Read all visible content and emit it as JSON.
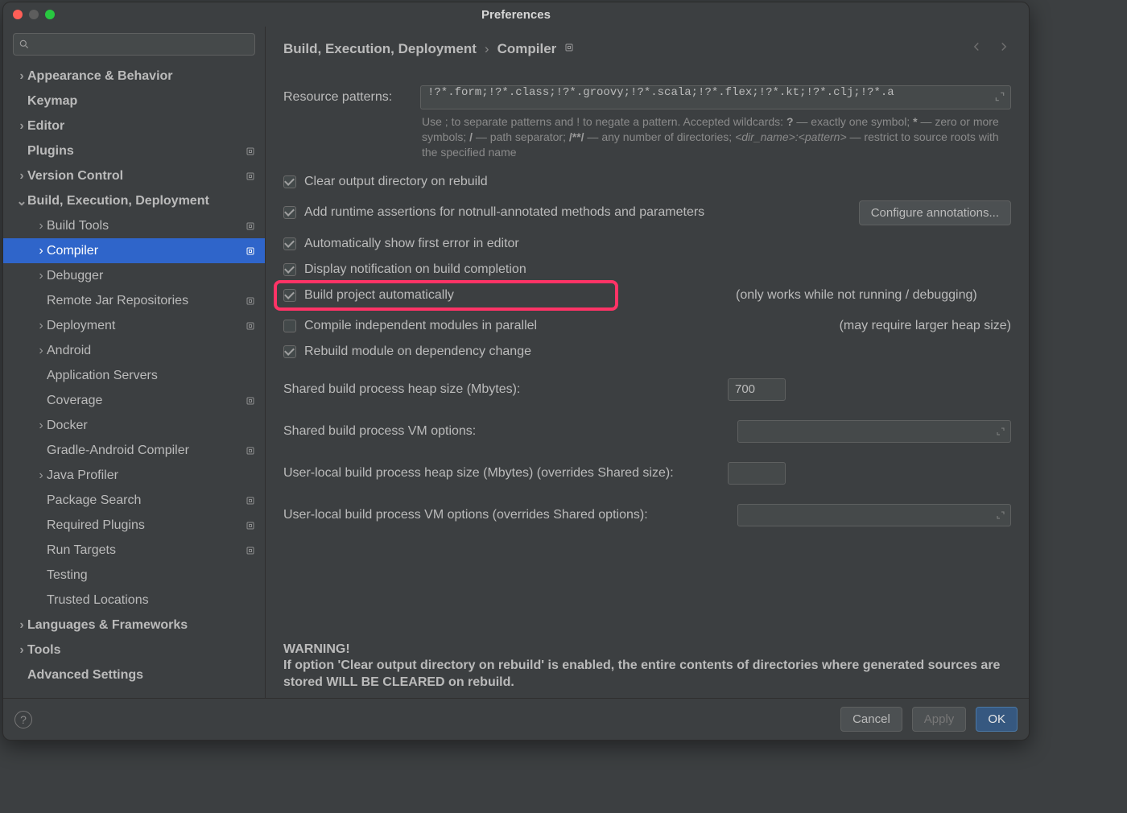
{
  "window_title": "Preferences",
  "search_placeholder": "",
  "breadcrumb": {
    "a": "Build, Execution, Deployment",
    "b": "Compiler"
  },
  "sidebar": [
    {
      "label": "Appearance & Behavior",
      "lvl": 0,
      "arrow": "right",
      "bold": true,
      "gear": false
    },
    {
      "label": "Keymap",
      "lvl": 0,
      "arrow": "",
      "bold": true,
      "gear": false
    },
    {
      "label": "Editor",
      "lvl": 0,
      "arrow": "right",
      "bold": true,
      "gear": false
    },
    {
      "label": "Plugins",
      "lvl": 0,
      "arrow": "",
      "bold": true,
      "gear": true
    },
    {
      "label": "Version Control",
      "lvl": 0,
      "arrow": "right",
      "bold": true,
      "gear": true
    },
    {
      "label": "Build, Execution, Deployment",
      "lvl": 0,
      "arrow": "down",
      "bold": true,
      "gear": false
    },
    {
      "label": "Build Tools",
      "lvl": 1,
      "arrow": "right",
      "bold": false,
      "gear": true
    },
    {
      "label": "Compiler",
      "lvl": 1,
      "arrow": "right",
      "bold": false,
      "gear": true,
      "selected": true
    },
    {
      "label": "Debugger",
      "lvl": 1,
      "arrow": "right",
      "bold": false,
      "gear": false
    },
    {
      "label": "Remote Jar Repositories",
      "lvl": 1,
      "arrow": "",
      "bold": false,
      "gear": true
    },
    {
      "label": "Deployment",
      "lvl": 1,
      "arrow": "right",
      "bold": false,
      "gear": true
    },
    {
      "label": "Android",
      "lvl": 1,
      "arrow": "right",
      "bold": false,
      "gear": false
    },
    {
      "label": "Application Servers",
      "lvl": 1,
      "arrow": "",
      "bold": false,
      "gear": false
    },
    {
      "label": "Coverage",
      "lvl": 1,
      "arrow": "",
      "bold": false,
      "gear": true
    },
    {
      "label": "Docker",
      "lvl": 1,
      "arrow": "right",
      "bold": false,
      "gear": false
    },
    {
      "label": "Gradle-Android Compiler",
      "lvl": 1,
      "arrow": "",
      "bold": false,
      "gear": true
    },
    {
      "label": "Java Profiler",
      "lvl": 1,
      "arrow": "right",
      "bold": false,
      "gear": false
    },
    {
      "label": "Package Search",
      "lvl": 1,
      "arrow": "",
      "bold": false,
      "gear": true
    },
    {
      "label": "Required Plugins",
      "lvl": 1,
      "arrow": "",
      "bold": false,
      "gear": true
    },
    {
      "label": "Run Targets",
      "lvl": 1,
      "arrow": "",
      "bold": false,
      "gear": true
    },
    {
      "label": "Testing",
      "lvl": 1,
      "arrow": "",
      "bold": false,
      "gear": false
    },
    {
      "label": "Trusted Locations",
      "lvl": 1,
      "arrow": "",
      "bold": false,
      "gear": false
    },
    {
      "label": "Languages & Frameworks",
      "lvl": 0,
      "arrow": "right",
      "bold": true,
      "gear": false
    },
    {
      "label": "Tools",
      "lvl": 0,
      "arrow": "right",
      "bold": true,
      "gear": false
    },
    {
      "label": "Advanced Settings",
      "lvl": 0,
      "arrow": "",
      "bold": true,
      "gear": false
    }
  ],
  "resource_label": "Resource patterns:",
  "resource_value": "!?*.form;!?*.class;!?*.groovy;!?*.scala;!?*.flex;!?*.kt;!?*.clj;!?*.a",
  "hint_parts": {
    "p1": "Use ; to separate patterns and ! to negate a pattern. Accepted wildcards: ",
    "q": "?",
    "p2": " — exactly one symbol; ",
    "star": "*",
    "p3": " — zero or more symbols; ",
    "slash": "/",
    "p4": " — path separator; ",
    "dblstar": "/**/",
    "p5": " — any number of directories; ",
    "dirpat": "<dir_name>:<pattern>",
    "p6": " — restrict to source roots with the specified name"
  },
  "checks": {
    "clear": "Clear output directory on rebuild",
    "assert": "Add runtime assertions for notnull-annotated methods and parameters",
    "autofirst": "Automatically show first error in editor",
    "notify": "Display notification on build completion",
    "auto": "Build project automatically",
    "parallel": "Compile independent modules in parallel",
    "depchange": "Rebuild module on dependency change"
  },
  "configure_btn": "Configure annotations...",
  "aside_auto": "(only works while not running / debugging)",
  "aside_parallel": "(may require larger heap size)",
  "fields": {
    "heap_label": "Shared build process heap size (Mbytes):",
    "heap_value": "700",
    "vm_label": "Shared build process VM options:",
    "vm_value": "",
    "ul_heap_label": "User-local build process heap size (Mbytes) (overrides Shared size):",
    "ul_heap_value": "",
    "ul_vm_label": "User-local build process VM options (overrides Shared options):",
    "ul_vm_value": ""
  },
  "warning_title": "WARNING!",
  "warning_body": "If option 'Clear output directory on rebuild' is enabled, the entire contents of directories where generated sources are stored WILL BE CLEARED on rebuild.",
  "footer": {
    "cancel": "Cancel",
    "apply": "Apply",
    "ok": "OK"
  }
}
